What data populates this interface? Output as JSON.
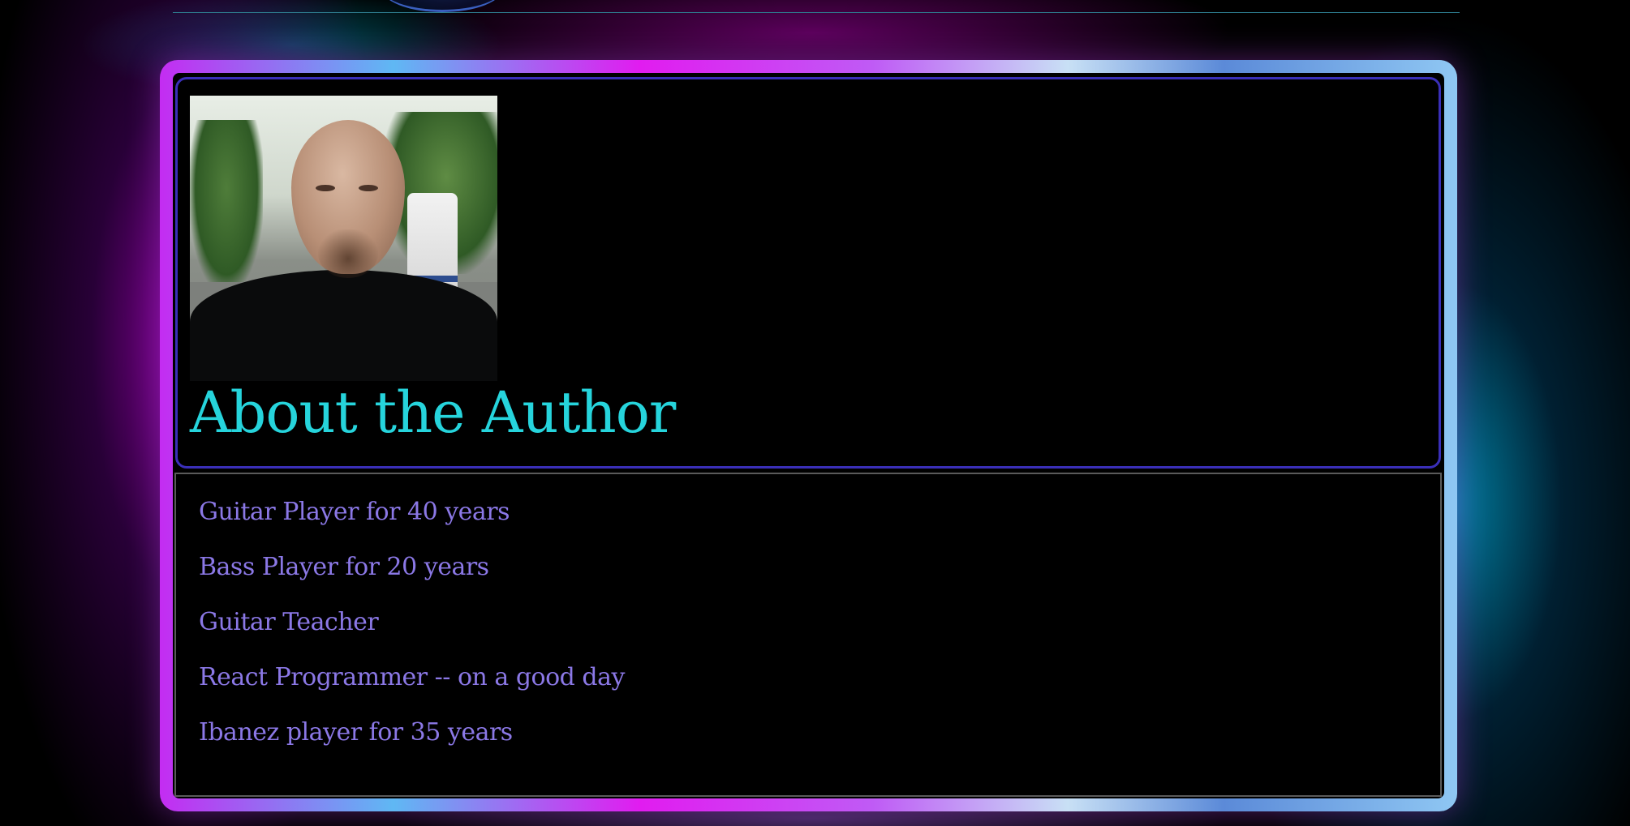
{
  "page": {
    "title": "About the Author"
  },
  "photo": {
    "alt": "Portrait of the author"
  },
  "facts": [
    "Guitar Player for 40 years",
    "Bass Player for 20 years",
    "Guitar Teacher",
    "React Programmer -- on a good day",
    "Ibanez player for 35 years"
  ],
  "colors": {
    "title": "#26d4dc",
    "facts": "#8b78e6",
    "card_border": "#3a2fb8",
    "background": "#000000"
  }
}
